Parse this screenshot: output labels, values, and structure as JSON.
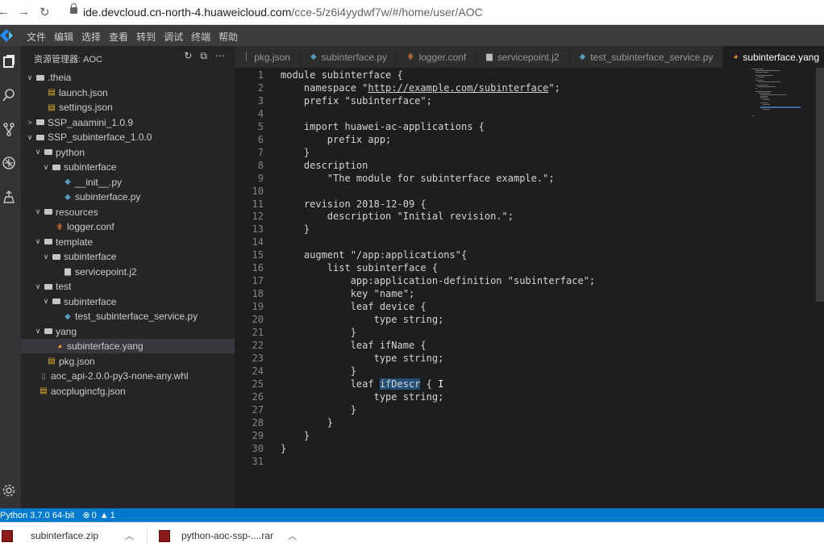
{
  "browser": {
    "url_host": "ide.devcloud.cn-north-4.huaweicloud.com",
    "url_path": "/cce-5/z6i4yydwf7w/#/home/user/AOC"
  },
  "menu": [
    "文件",
    "编辑",
    "选择",
    "查看",
    "转到",
    "调试",
    "终端",
    "帮助"
  ],
  "sidebar": {
    "title": "资源管理器: AOC",
    "tree": [
      {
        "label": ".theia",
        "type": "folder",
        "depth": 0,
        "open": true
      },
      {
        "label": "launch.json",
        "type": "json",
        "depth": 1
      },
      {
        "label": "settings.json",
        "type": "json",
        "depth": 1
      },
      {
        "label": "SSP_aaamini_1.0.9",
        "type": "folder",
        "depth": 0,
        "open": false
      },
      {
        "label": "SSP_subinterface_1.0.0",
        "type": "folder",
        "depth": 0,
        "open": true
      },
      {
        "label": "python",
        "type": "folder",
        "depth": 1,
        "open": true
      },
      {
        "label": "subinterface",
        "type": "folder",
        "depth": 2,
        "open": true
      },
      {
        "label": "__init__.py",
        "type": "py",
        "depth": 3
      },
      {
        "label": "subinterface.py",
        "type": "py",
        "depth": 3
      },
      {
        "label": "resources",
        "type": "folder",
        "depth": 1,
        "open": true
      },
      {
        "label": "logger.conf",
        "type": "conf",
        "depth": 2
      },
      {
        "label": "template",
        "type": "folder",
        "depth": 1,
        "open": true
      },
      {
        "label": "subinterface",
        "type": "folder",
        "depth": 2,
        "open": true
      },
      {
        "label": "servicepoint.j2",
        "type": "file",
        "depth": 3
      },
      {
        "label": "test",
        "type": "folder",
        "depth": 1,
        "open": true
      },
      {
        "label": "subinterface",
        "type": "folder",
        "depth": 2,
        "open": true
      },
      {
        "label": "test_subinterface_service.py",
        "type": "py",
        "depth": 3
      },
      {
        "label": "yang",
        "type": "folder",
        "depth": 1,
        "open": true
      },
      {
        "label": "subinterface.yang",
        "type": "yang",
        "depth": 2,
        "selected": true
      },
      {
        "label": "pkg.json",
        "type": "json",
        "depth": 1
      },
      {
        "label": "aoc_api-2.0.0-py3-none-any.whl",
        "type": "whl",
        "depth": 0
      },
      {
        "label": "aocplugincfg.json",
        "type": "json",
        "depth": 0
      }
    ]
  },
  "tabs": [
    {
      "label": "pkg.json",
      "icon": "json-icon",
      "active": false
    },
    {
      "label": "subinterface.py",
      "icon": "python-icon",
      "active": false
    },
    {
      "label": "logger.conf",
      "icon": "config-icon",
      "active": false
    },
    {
      "label": "servicepoint.j2",
      "icon": "file-icon",
      "active": false
    },
    {
      "label": "test_subinterface_service.py",
      "icon": "python-icon",
      "active": false
    },
    {
      "label": "subinterface.yang",
      "icon": "yang-icon",
      "active": true
    }
  ],
  "editor": {
    "lines": [
      "module subinterface {",
      "    namespace \"http://example.com/subinterface\";",
      "    prefix \"subinterface\";",
      "",
      "    import huawei-ac-applications {",
      "        prefix app;",
      "    }",
      "    description",
      "        \"The module for subinterface example.\";",
      "",
      "    revision 2018-12-09 {",
      "        description \"Initial revision.\";",
      "    }",
      "",
      "    augment \"/app:applications\"{",
      "        list subinterface {",
      "            app:application-definition \"subinterface\";",
      "            key \"name\";",
      "            leaf device {",
      "                type string;",
      "            }",
      "            leaf ifName {",
      "                type string;",
      "            }",
      "            leaf ifDescr {",
      "                type string;",
      "            }",
      "        }",
      "    }",
      "}",
      ""
    ],
    "highlight_word": "ifDescr"
  },
  "status": {
    "python": "Python 3.7.0 64-bit",
    "errors": "0",
    "warnings": "1"
  },
  "downloads": [
    {
      "name": "subinterface.zip"
    },
    {
      "name": "python-aoc-ssp-....rar"
    }
  ],
  "colors": {
    "accent": "#007acc",
    "editor_bg": "#1e1e1e",
    "sidebar_bg": "#252526"
  }
}
